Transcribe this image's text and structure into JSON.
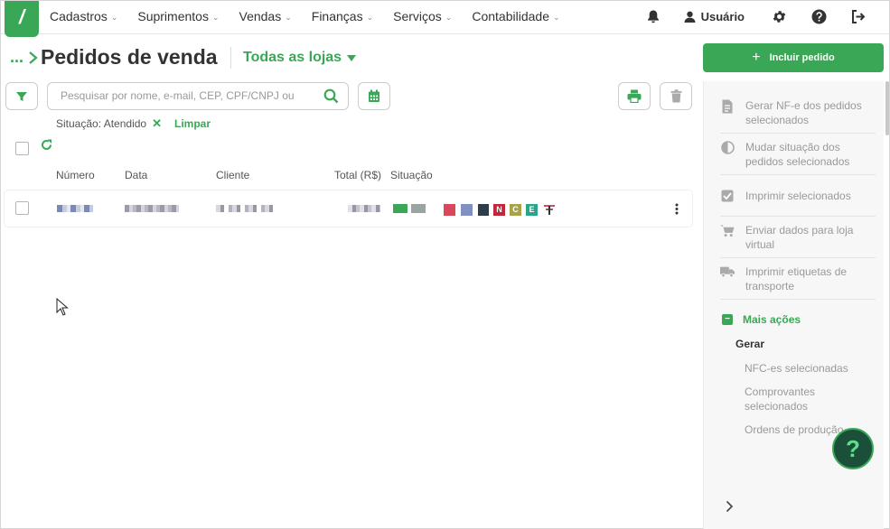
{
  "nav": {
    "logo": "/",
    "items": [
      "Cadastros",
      "Suprimentos",
      "Vendas",
      "Finanças",
      "Serviços",
      "Contabilidade"
    ],
    "user": "Usuário"
  },
  "header": {
    "crumb": "...",
    "title": "Pedidos de venda",
    "store": "Todas as lojas",
    "include_button": "Incluir pedido"
  },
  "search": {
    "placeholder": "Pesquisar por nome, e-mail, CEP, CPF/CNPJ ou"
  },
  "filter": {
    "label": "Situação: Atendido",
    "clear": "Limpar"
  },
  "table": {
    "columns": [
      "Número",
      "Data",
      "Cliente",
      "Total (R$)",
      "Situação"
    ],
    "tags": [
      "N",
      "C",
      "E"
    ]
  },
  "sidebar": {
    "actions": [
      "Gerar NF-e dos pedidos selecionados",
      "Mudar situação dos pedidos selecionados",
      "Imprimir selecionados",
      "Enviar dados para loja virtual",
      "Imprimir etiquetas de transporte"
    ],
    "more": "Mais ações",
    "more_minus": "−",
    "generate_heading": "Gerar",
    "generate_links": [
      "NFC-es selecionadas",
      "Comprovantes selecionados",
      "Ordens de produção"
    ]
  },
  "colors": {
    "accent": "#3aa757",
    "help_bg": "#1c4f3a"
  },
  "help": "?"
}
